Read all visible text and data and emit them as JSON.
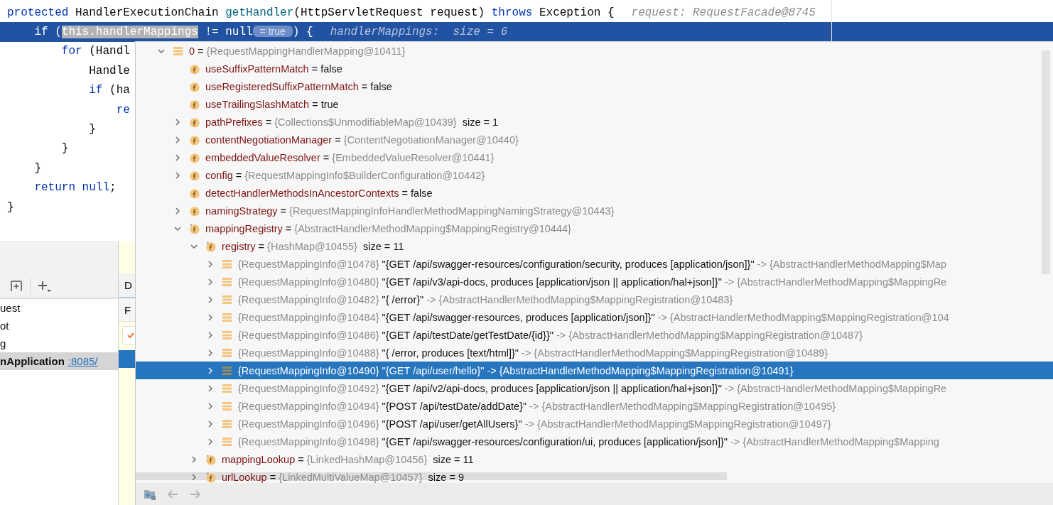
{
  "editor": {
    "lines": [
      {
        "current": false,
        "tokens": [
          {
            "text": "protected",
            "kind": "keyword"
          },
          {
            "text": " HandlerExecutionChain ",
            "kind": "plain"
          },
          {
            "text": "getHandler",
            "kind": "method"
          },
          {
            "text": "(HttpServletRequest request) ",
            "kind": "plain"
          },
          {
            "text": "throws",
            "kind": "keyword"
          },
          {
            "text": " Exception {",
            "kind": "plain"
          }
        ],
        "hint": "request: RequestFacade@8745"
      },
      {
        "current": true,
        "tokens": [
          {
            "text": "    if",
            "kind": "keyword"
          },
          {
            "text": " (",
            "kind": "plain"
          },
          {
            "text": "this.handlerMappings",
            "kind": "selection"
          },
          {
            "text": " != null",
            "kind": "plain"
          },
          {
            "text": "= true",
            "kind": "inline-value"
          },
          {
            "text": ") {",
            "kind": "plain"
          }
        ],
        "hint": "handlerMappings:  size = 6"
      },
      {
        "current": false,
        "tokens": [
          {
            "text": "        for",
            "kind": "keyword"
          },
          {
            "text": " (Handl",
            "kind": "plain"
          }
        ]
      },
      {
        "current": false,
        "tokens": [
          {
            "text": "            Handle",
            "kind": "plain"
          }
        ]
      },
      {
        "current": false,
        "tokens": [
          {
            "text": "            if",
            "kind": "keyword"
          },
          {
            "text": " (ha",
            "kind": "plain"
          }
        ]
      },
      {
        "current": false,
        "tokens": [
          {
            "text": "                re",
            "kind": "keyword"
          }
        ]
      },
      {
        "current": false,
        "tokens": [
          {
            "text": "            }",
            "kind": "plain"
          }
        ]
      },
      {
        "current": false,
        "tokens": [
          {
            "text": "        }",
            "kind": "plain"
          }
        ]
      },
      {
        "current": false,
        "tokens": [
          {
            "text": "    }",
            "kind": "plain"
          }
        ]
      },
      {
        "current": false,
        "tokens": [
          {
            "text": "    return",
            "kind": "keyword"
          },
          {
            "text": " null",
            "kind": "keyword"
          },
          {
            "text": ";",
            "kind": "plain"
          }
        ]
      },
      {
        "current": false,
        "tokens": [
          {
            "text": "}",
            "kind": "plain"
          }
        ]
      }
    ]
  },
  "services": {
    "items": [
      {
        "text": "uest",
        "selected": false
      },
      {
        "text": "ot",
        "selected": false
      },
      {
        "text": "g",
        "selected": false
      },
      {
        "text": "nApplication",
        "link": ":8085/",
        "selected": true
      }
    ]
  },
  "side_column": {
    "header": "D",
    "subheader": "F"
  },
  "variables": [
    {
      "kind": "element",
      "name": "0",
      "separator": "=",
      "object": "{RequestMappingHandlerMapping@10411}",
      "expanded": true,
      "selected": false,
      "children": [
        {
          "kind": "field",
          "name": "useSuffixPatternMatch",
          "separator": "=",
          "value": "false",
          "selected": false
        },
        {
          "kind": "field",
          "name": "useRegisteredSuffixPatternMatch",
          "separator": "=",
          "value": "false",
          "selected": false
        },
        {
          "kind": "field",
          "name": "useTrailingSlashMatch",
          "separator": "=",
          "value": "true",
          "selected": false
        },
        {
          "kind": "field",
          "name": "pathPrefixes",
          "separator": "=",
          "object": "{Collections$UnmodifiableMap@10439}",
          "size": "size = 1",
          "expanded": false,
          "selected": false
        },
        {
          "kind": "field",
          "name": "contentNegotiationManager",
          "separator": "=",
          "object": "{ContentNegotiationManager@10440}",
          "expanded": false,
          "selected": false
        },
        {
          "kind": "field",
          "name": "embeddedValueResolver",
          "separator": "=",
          "object": "{EmbeddedValueResolver@10441}",
          "expanded": false,
          "selected": false
        },
        {
          "kind": "field",
          "name": "config",
          "separator": "=",
          "object": "{RequestMappingInfo$BuilderConfiguration@10442}",
          "expanded": false,
          "selected": false
        },
        {
          "kind": "field",
          "name": "detectHandlerMethodsInAncestorContexts",
          "separator": "=",
          "value": "false",
          "selected": false
        },
        {
          "kind": "field",
          "name": "namingStrategy",
          "separator": "=",
          "object": "{RequestMappingInfoHandlerMethodMappingNamingStrategy@10443}",
          "expanded": false,
          "selected": false
        },
        {
          "kind": "static",
          "name": "mappingRegistry",
          "separator": "=",
          "object": "{AbstractHandlerMethodMapping$MappingRegistry@10444}",
          "expanded": true,
          "selected": false,
          "children": [
            {
              "kind": "static",
              "name": "registry",
              "separator": "=",
              "object": "{HashMap@10455}",
              "size": "size = 11",
              "expanded": true,
              "selected": false,
              "children": [
                {
                  "kind": "entry",
                  "key": "{RequestMappingInfo@10478}",
                  "entry": "\"{GET /api/swagger-resources/configuration/security, produces [application/json]}\"",
                  "target": "-> {AbstractHandlerMethodMapping$Map",
                  "expanded": false,
                  "selected": false
                },
                {
                  "kind": "entry",
                  "key": "{RequestMappingInfo@10480}",
                  "entry": "\"{GET /api/v3/api-docs, produces [application/json || application/hal+json]}\"",
                  "target": "-> {AbstractHandlerMethodMapping$MappingRe",
                  "expanded": false,
                  "selected": false
                },
                {
                  "kind": "entry",
                  "key": "{RequestMappingInfo@10482}",
                  "entry": "\"{ /error}\"",
                  "target": "-> {AbstractHandlerMethodMapping$MappingRegistration@10483}",
                  "expanded": false,
                  "selected": false
                },
                {
                  "kind": "entry",
                  "key": "{RequestMappingInfo@10484}",
                  "entry": "\"{GET /api/swagger-resources, produces [application/json]}\"",
                  "target": "-> {AbstractHandlerMethodMapping$MappingRegistration@104",
                  "expanded": false,
                  "selected": false
                },
                {
                  "kind": "entry",
                  "key": "{RequestMappingInfo@10486}",
                  "entry": "\"{GET /api/testDate/getTestDate/{id}}\"",
                  "target": "-> {AbstractHandlerMethodMapping$MappingRegistration@10487}",
                  "expanded": false,
                  "selected": false
                },
                {
                  "kind": "entry",
                  "key": "{RequestMappingInfo@10488}",
                  "entry": "\"{ /error, produces [text/html]}\"",
                  "target": "-> {AbstractHandlerMethodMapping$MappingRegistration@10489}",
                  "expanded": false,
                  "selected": false
                },
                {
                  "kind": "entry",
                  "key": "{RequestMappingInfo@10490}",
                  "entry": "\"{GET /api/user/hello}\"",
                  "target": "-> {AbstractHandlerMethodMapping$MappingRegistration@10491}",
                  "expanded": false,
                  "selected": true
                },
                {
                  "kind": "entry",
                  "key": "{RequestMappingInfo@10492}",
                  "entry": "\"{GET /api/v2/api-docs, produces [application/json || application/hal+json]}\"",
                  "target": "-> {AbstractHandlerMethodMapping$MappingRe",
                  "expanded": false,
                  "selected": false
                },
                {
                  "kind": "entry",
                  "key": "{RequestMappingInfo@10494}",
                  "entry": "\"{POST /api/testDate/addDate}\"",
                  "target": "-> {AbstractHandlerMethodMapping$MappingRegistration@10495}",
                  "expanded": false,
                  "selected": false
                },
                {
                  "kind": "entry",
                  "key": "{RequestMappingInfo@10496}",
                  "entry": "\"{POST /api/user/getAllUsers}\"",
                  "target": "-> {AbstractHandlerMethodMapping$MappingRegistration@10497}",
                  "expanded": false,
                  "selected": false
                },
                {
                  "kind": "entry",
                  "key": "{RequestMappingInfo@10498}",
                  "entry": "\"{GET /api/swagger-resources/configuration/ui, produces [application/json]}\"",
                  "target": "-> {AbstractHandlerMethodMapping$Mapping",
                  "expanded": false,
                  "selected": false
                }
              ]
            },
            {
              "kind": "static",
              "name": "mappingLookup",
              "separator": "=",
              "object": "{LinkedHashMap@10456}",
              "size": "size = 11",
              "expanded": false,
              "selected": false
            },
            {
              "kind": "static",
              "name": "urlLookup",
              "separator": "=",
              "object": "{LinkedMultiValueMap@10457}",
              "size": "size = 9",
              "expanded": false,
              "selected": false
            }
          ]
        }
      ]
    }
  ]
}
